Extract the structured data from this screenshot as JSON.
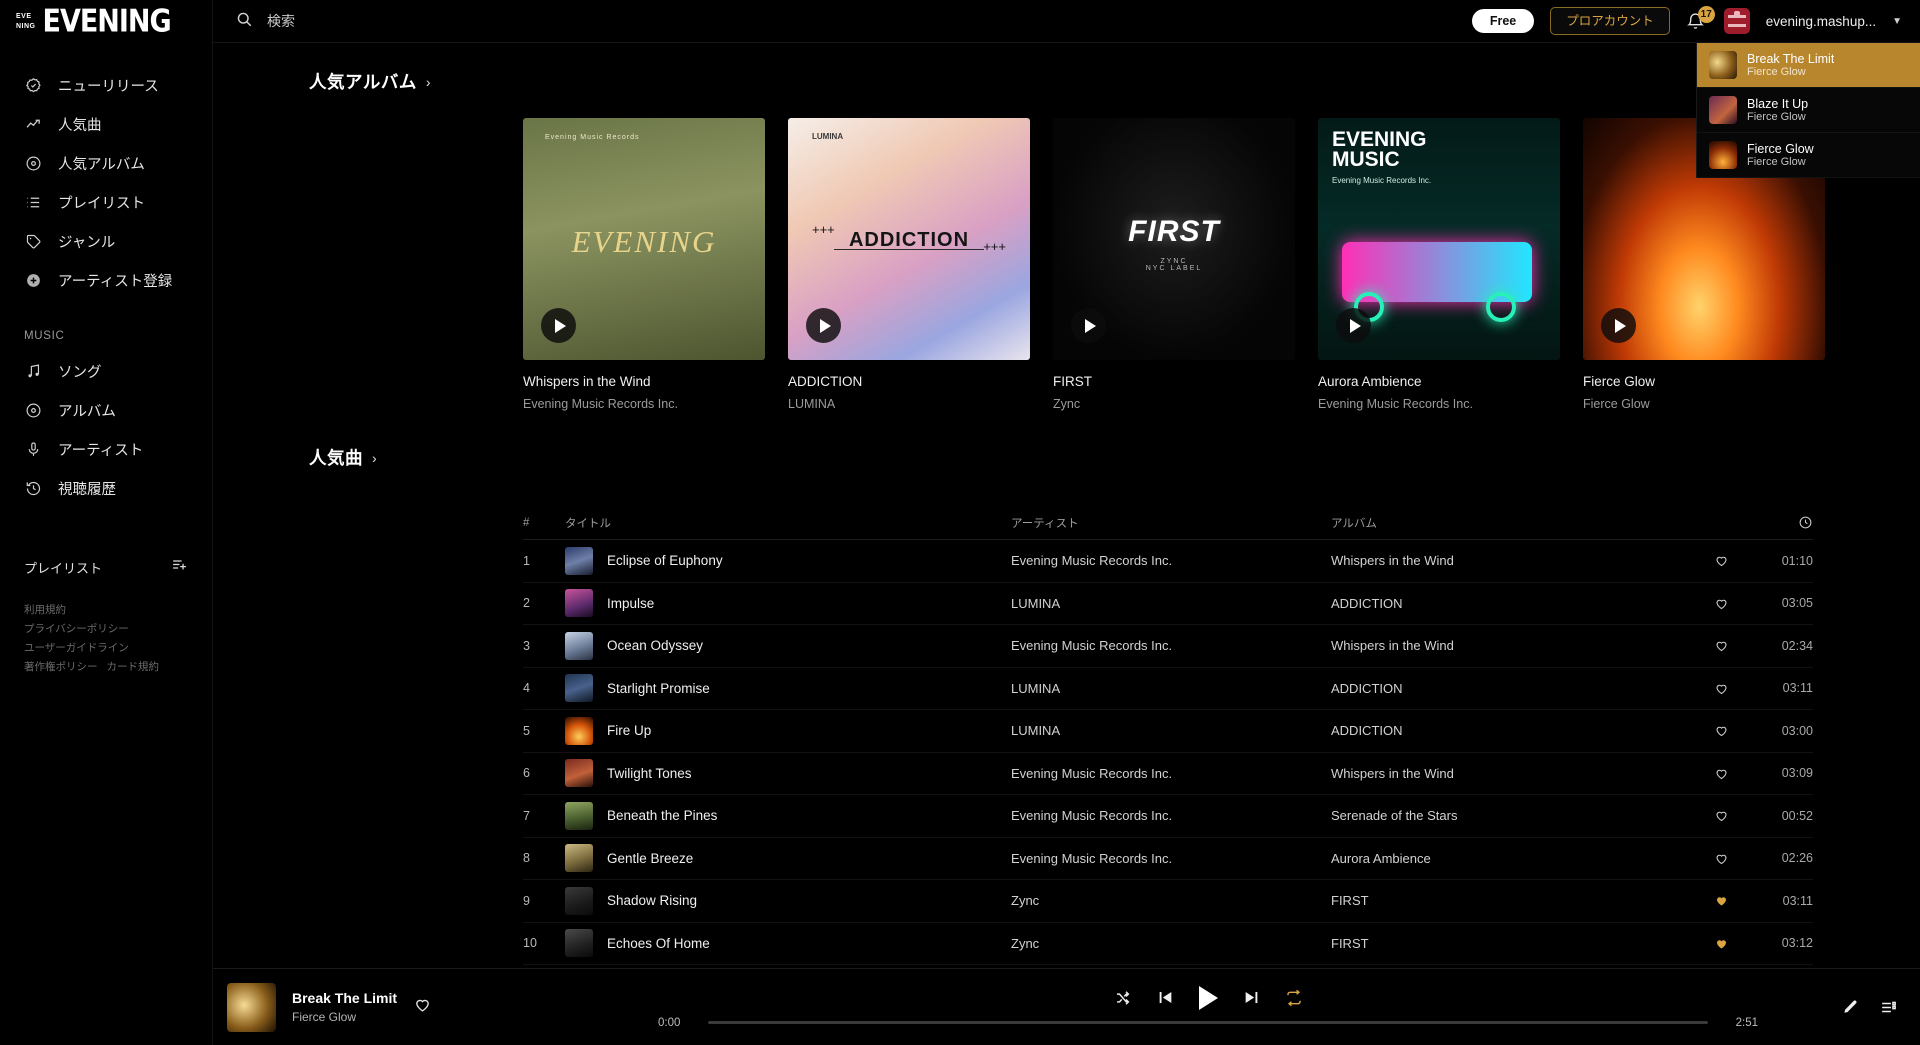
{
  "brand": {
    "mini_line1": "EVE",
    "mini_line2": "NING",
    "word": "EVENING"
  },
  "search": {
    "placeholder": "検索",
    "value": ""
  },
  "header": {
    "free_label": "Free",
    "pro_label": "プロアカウント",
    "notification_count": "17",
    "username": "evening.mashup...",
    "bell_icon": "bell-icon",
    "avatar_icon": "user-avatar",
    "caret_icon": "chevron-down-icon"
  },
  "queue": {
    "items": [
      {
        "title": "Break The Limit",
        "artist": "Fierce Glow",
        "active": true
      },
      {
        "title": "Blaze It Up",
        "artist": "Fierce Glow",
        "active": false
      },
      {
        "title": "Fierce Glow",
        "artist": "Fierce Glow",
        "active": false
      }
    ]
  },
  "sidebar": {
    "items": [
      {
        "label": "ニューリリース",
        "icon": "badge-check-icon"
      },
      {
        "label": "人気曲",
        "icon": "trending-up-icon"
      },
      {
        "label": "人気アルバム",
        "icon": "disc-icon"
      },
      {
        "label": "プレイリスト",
        "icon": "list-icon"
      },
      {
        "label": "ジャンル",
        "icon": "tag-icon"
      },
      {
        "label": "アーティスト登録",
        "icon": "plus-circle-icon"
      }
    ],
    "music_section_label": "MUSIC",
    "music_items": [
      {
        "label": "ソング",
        "icon": "music-note-icon"
      },
      {
        "label": "アルバム",
        "icon": "disc-icon"
      },
      {
        "label": "アーティスト",
        "icon": "microphone-icon"
      },
      {
        "label": "視聴履歴",
        "icon": "history-icon"
      }
    ],
    "playlist_label": "プレイリスト",
    "playlist_add_icon": "list-plus-icon",
    "legal": [
      [
        "利用規約",
        "プライバシーポリシー"
      ],
      [
        "ユーザーガイドライン"
      ],
      [
        "著作権ポリシー",
        "カード規約"
      ]
    ]
  },
  "albums_section": {
    "heading": "人気アルバム",
    "chevron": "›",
    "prev_icon": "chevron-left-icon",
    "next_icon": "chevron-right-icon",
    "items": [
      {
        "title": "Whispers in the Wind",
        "artist": "Evening Music Records Inc.",
        "cover": "field-evening"
      },
      {
        "title": "ADDICTION",
        "artist": "LUMINA",
        "cover": "addiction-gradient"
      },
      {
        "title": "FIRST",
        "artist": "Zync",
        "cover": "first-dark"
      },
      {
        "title": "Aurora Ambience",
        "artist": "Evening Music Records Inc.",
        "cover": "neon-truck"
      },
      {
        "title": "Fierce Glow",
        "artist": "Fierce Glow",
        "cover": "fire"
      }
    ]
  },
  "tracks_section": {
    "heading": "人気曲",
    "chevron": "›",
    "columns": {
      "num": "#",
      "title": "タイトル",
      "artist": "アーティスト",
      "album": "アルバム",
      "duration_icon": "clock-icon"
    },
    "rows": [
      {
        "num": "1",
        "title": "Eclipse of Euphony",
        "artist": "Evening Music Records Inc.",
        "album": "Whispers in the Wind",
        "liked": false,
        "time": "01:10",
        "thumb": "c1"
      },
      {
        "num": "2",
        "title": "Impulse",
        "artist": "LUMINA",
        "album": "ADDICTION",
        "liked": false,
        "time": "03:05",
        "thumb": "c2"
      },
      {
        "num": "3",
        "title": "Ocean Odyssey",
        "artist": "Evening Music Records Inc.",
        "album": "Whispers in the Wind",
        "liked": false,
        "time": "02:34",
        "thumb": "c3"
      },
      {
        "num": "4",
        "title": "Starlight Promise",
        "artist": "LUMINA",
        "album": "ADDICTION",
        "liked": false,
        "time": "03:11",
        "thumb": "c4"
      },
      {
        "num": "5",
        "title": "Fire Up",
        "artist": "LUMINA",
        "album": "ADDICTION",
        "liked": false,
        "time": "03:00",
        "thumb": "c5"
      },
      {
        "num": "6",
        "title": "Twilight Tones",
        "artist": "Evening Music Records Inc.",
        "album": "Whispers in the Wind",
        "liked": false,
        "time": "03:09",
        "thumb": "c6"
      },
      {
        "num": "7",
        "title": "Beneath the Pines",
        "artist": "Evening Music Records Inc.",
        "album": "Serenade of the Stars",
        "liked": false,
        "time": "00:52",
        "thumb": "c7"
      },
      {
        "num": "8",
        "title": "Gentle Breeze",
        "artist": "Evening Music Records Inc.",
        "album": "Aurora Ambience",
        "liked": false,
        "time": "02:26",
        "thumb": "c8"
      },
      {
        "num": "9",
        "title": "Shadow Rising",
        "artist": "Zync",
        "album": "FIRST",
        "liked": true,
        "time": "03:11",
        "thumb": "c9"
      },
      {
        "num": "10",
        "title": "Echoes Of Home",
        "artist": "Zync",
        "album": "FIRST",
        "liked": true,
        "time": "03:12",
        "thumb": "c10"
      }
    ]
  },
  "player": {
    "title": "Break The Limit",
    "artist": "Fierce Glow",
    "like_icon": "heart-icon",
    "shuffle_icon": "shuffle-icon",
    "prev_icon": "skip-back-icon",
    "play_icon": "play-icon",
    "next_icon": "skip-forward-icon",
    "repeat_icon": "repeat-icon",
    "elapsed": "0:00",
    "duration": "2:51",
    "progress_percent": "0",
    "mic_icon": "microphone-icon",
    "queue_icon": "queue-list-icon",
    "volume_icon": "volume-icon",
    "volume_percent": "100",
    "expand_icon": "chevron-up-icon"
  },
  "colors": {
    "accent": "#d9a441",
    "accent_dark": "#b8862c",
    "bg": "#000000"
  }
}
